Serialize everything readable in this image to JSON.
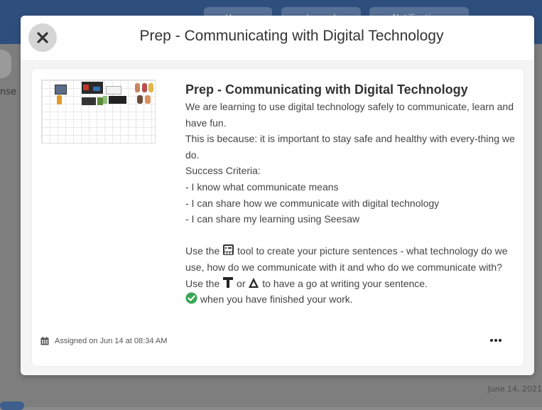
{
  "background": {
    "tabs": [
      {
        "label": "Home"
      },
      {
        "label": "Journal"
      },
      {
        "label": "Notifications"
      }
    ],
    "side_text": "nse",
    "date": "June 14, 2021"
  },
  "modal": {
    "close_icon": "close-icon",
    "title": "Prep - Communicating with Digital Technology"
  },
  "activity": {
    "title": "Prep - Communicating with Digital Technology",
    "lines": [
      "We are learning to use digital technology safely to communicate, learn and have fun.",
      "This is because: it is important to stay safe and healthy with every-thing we do.",
      "Success Criteria:",
      "- I know what communicate means",
      "- I can share how we communicate with digital technology",
      "- I can share my learning using Seesaw"
    ],
    "instruction1_before": "Use the",
    "instruction1_icon": "photo-tool-icon",
    "instruction1_after": "tool to create your picture sentences - what technology do we use, how do we communicate with it and who do we communicate with?",
    "instruction2_before": "Use the",
    "instruction2_icon1": "text-tool-icon",
    "instruction2_middle": "or",
    "instruction2_icon2": "pen-tool-icon",
    "instruction2_after": "to have a go at writing your sentence.",
    "instruction3_icon": "check-circle-icon",
    "instruction3_after": "when you have finished your work.",
    "assigned_icon": "calendar-icon",
    "assigned_text": "Assigned on Jun 14 at 08:34 AM",
    "more_icon": "more-icon",
    "accent_green": "#3aa655"
  }
}
